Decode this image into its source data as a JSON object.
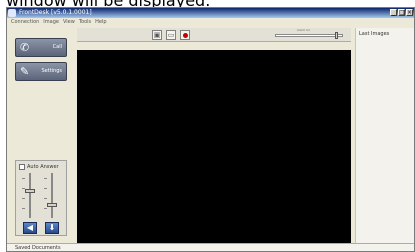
{
  "caption": {
    "text": "window will be displayed."
  },
  "window": {
    "title": "FrontDesk [v5.0.1.0001]"
  },
  "menu": [
    "Connection",
    "Image",
    "View",
    "Tools",
    "Help"
  ],
  "left_panel": {
    "call_label": "Call",
    "settings_label": "Settings",
    "auto_answer_label": "Auto Answer",
    "auto_answer_checked": false
  },
  "toolbar": {
    "zoom_label": "zoom lvl",
    "zoom_level": 0.9
  },
  "right_panel": {
    "title": "Last Images"
  },
  "status_bar": {
    "text": "Saved Documents"
  },
  "colors": {
    "record": "#c00000",
    "video_bg": "#000000",
    "title_bar": "#0a246a"
  }
}
